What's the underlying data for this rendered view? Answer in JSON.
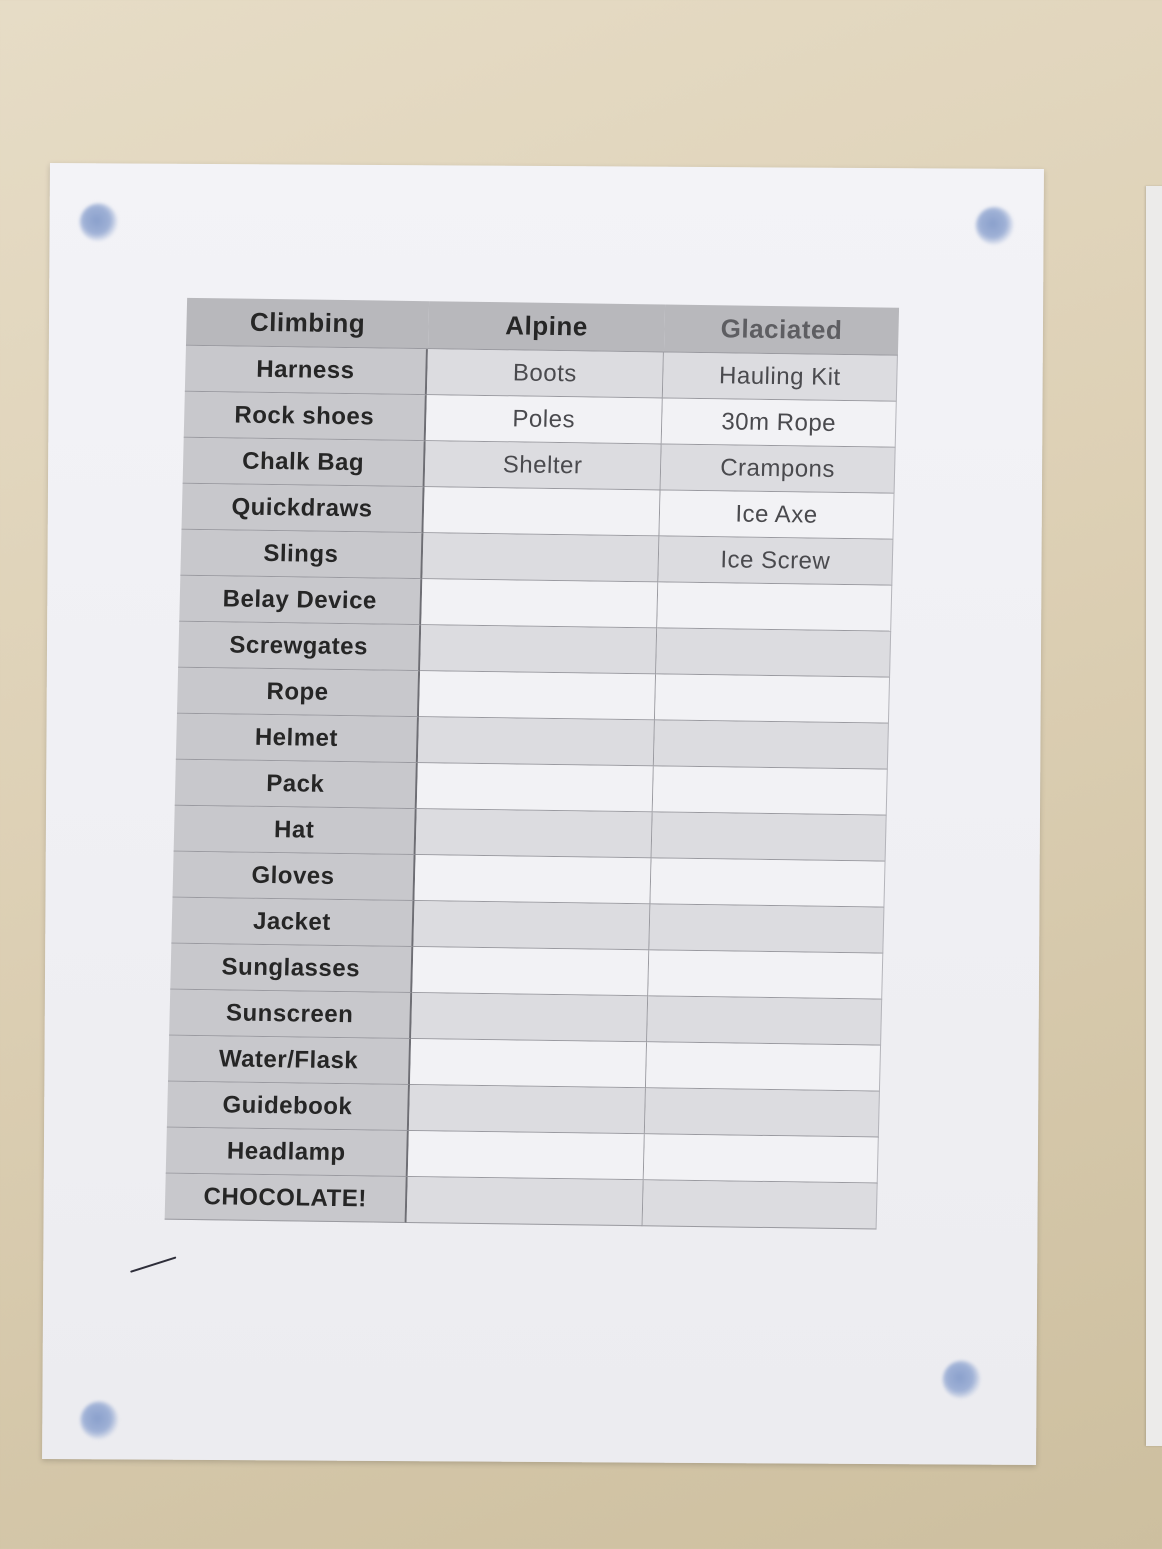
{
  "table": {
    "headers": [
      "Climbing",
      "Alpine",
      "Glaciated"
    ],
    "climbing": [
      "Harness",
      "Rock shoes",
      "Chalk Bag",
      "Quickdraws",
      "Slings",
      "Belay Device",
      "Screwgates",
      "Rope",
      "Helmet",
      "Pack",
      "Hat",
      "Gloves",
      "Jacket",
      "Sunglasses",
      "Sunscreen",
      "Water/Flask",
      "Guidebook",
      "Headlamp",
      "CHOCOLATE!"
    ],
    "alpine": [
      "Boots",
      "Poles",
      "Shelter",
      "",
      "",
      "",
      "",
      "",
      "",
      "",
      "",
      "",
      "",
      "",
      "",
      "",
      "",
      "",
      ""
    ],
    "glaciated": [
      "Hauling Kit",
      "30m Rope",
      "Crampons",
      "Ice Axe",
      "Ice Screw",
      "",
      "",
      "",
      "",
      "",
      "",
      "",
      "",
      "",
      "",
      "",
      "",
      "",
      ""
    ]
  },
  "colors": {
    "wall": "#ddd0b5",
    "paper": "#f0f0f4",
    "header_fill": "#b8b8bc",
    "climbing_column_fill": "#c8c8cc",
    "pin": "#9fb1d6"
  },
  "icons": [
    "pushpin-icon",
    "pen-mark-icon"
  ]
}
